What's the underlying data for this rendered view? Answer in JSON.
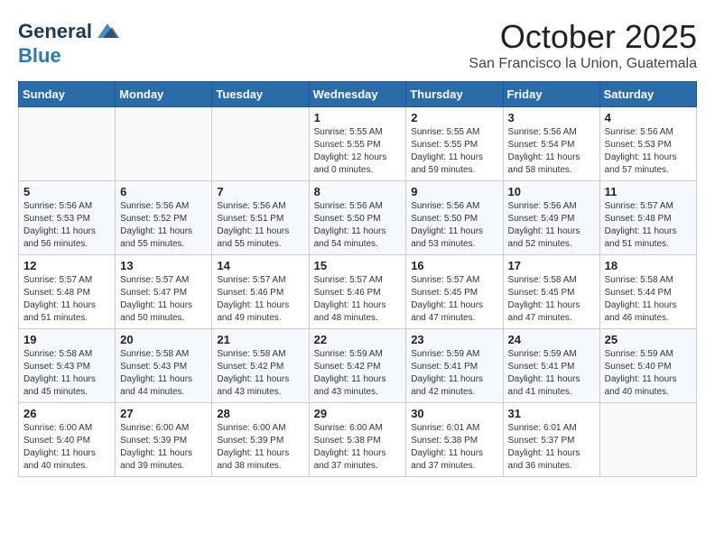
{
  "logo": {
    "line1": "General",
    "line2": "Blue"
  },
  "title": "October 2025",
  "subtitle": "San Francisco la Union, Guatemala",
  "weekdays": [
    "Sunday",
    "Monday",
    "Tuesday",
    "Wednesday",
    "Thursday",
    "Friday",
    "Saturday"
  ],
  "weeks": [
    [
      {
        "day": "",
        "info": ""
      },
      {
        "day": "",
        "info": ""
      },
      {
        "day": "",
        "info": ""
      },
      {
        "day": "1",
        "info": "Sunrise: 5:55 AM\nSunset: 5:55 PM\nDaylight: 12 hours\nand 0 minutes."
      },
      {
        "day": "2",
        "info": "Sunrise: 5:55 AM\nSunset: 5:55 PM\nDaylight: 11 hours\nand 59 minutes."
      },
      {
        "day": "3",
        "info": "Sunrise: 5:56 AM\nSunset: 5:54 PM\nDaylight: 11 hours\nand 58 minutes."
      },
      {
        "day": "4",
        "info": "Sunrise: 5:56 AM\nSunset: 5:53 PM\nDaylight: 11 hours\nand 57 minutes."
      }
    ],
    [
      {
        "day": "5",
        "info": "Sunrise: 5:56 AM\nSunset: 5:53 PM\nDaylight: 11 hours\nand 56 minutes."
      },
      {
        "day": "6",
        "info": "Sunrise: 5:56 AM\nSunset: 5:52 PM\nDaylight: 11 hours\nand 55 minutes."
      },
      {
        "day": "7",
        "info": "Sunrise: 5:56 AM\nSunset: 5:51 PM\nDaylight: 11 hours\nand 55 minutes."
      },
      {
        "day": "8",
        "info": "Sunrise: 5:56 AM\nSunset: 5:50 PM\nDaylight: 11 hours\nand 54 minutes."
      },
      {
        "day": "9",
        "info": "Sunrise: 5:56 AM\nSunset: 5:50 PM\nDaylight: 11 hours\nand 53 minutes."
      },
      {
        "day": "10",
        "info": "Sunrise: 5:56 AM\nSunset: 5:49 PM\nDaylight: 11 hours\nand 52 minutes."
      },
      {
        "day": "11",
        "info": "Sunrise: 5:57 AM\nSunset: 5:48 PM\nDaylight: 11 hours\nand 51 minutes."
      }
    ],
    [
      {
        "day": "12",
        "info": "Sunrise: 5:57 AM\nSunset: 5:48 PM\nDaylight: 11 hours\nand 51 minutes."
      },
      {
        "day": "13",
        "info": "Sunrise: 5:57 AM\nSunset: 5:47 PM\nDaylight: 11 hours\nand 50 minutes."
      },
      {
        "day": "14",
        "info": "Sunrise: 5:57 AM\nSunset: 5:46 PM\nDaylight: 11 hours\nand 49 minutes."
      },
      {
        "day": "15",
        "info": "Sunrise: 5:57 AM\nSunset: 5:46 PM\nDaylight: 11 hours\nand 48 minutes."
      },
      {
        "day": "16",
        "info": "Sunrise: 5:57 AM\nSunset: 5:45 PM\nDaylight: 11 hours\nand 47 minutes."
      },
      {
        "day": "17",
        "info": "Sunrise: 5:58 AM\nSunset: 5:45 PM\nDaylight: 11 hours\nand 47 minutes."
      },
      {
        "day": "18",
        "info": "Sunrise: 5:58 AM\nSunset: 5:44 PM\nDaylight: 11 hours\nand 46 minutes."
      }
    ],
    [
      {
        "day": "19",
        "info": "Sunrise: 5:58 AM\nSunset: 5:43 PM\nDaylight: 11 hours\nand 45 minutes."
      },
      {
        "day": "20",
        "info": "Sunrise: 5:58 AM\nSunset: 5:43 PM\nDaylight: 11 hours\nand 44 minutes."
      },
      {
        "day": "21",
        "info": "Sunrise: 5:58 AM\nSunset: 5:42 PM\nDaylight: 11 hours\nand 43 minutes."
      },
      {
        "day": "22",
        "info": "Sunrise: 5:59 AM\nSunset: 5:42 PM\nDaylight: 11 hours\nand 43 minutes."
      },
      {
        "day": "23",
        "info": "Sunrise: 5:59 AM\nSunset: 5:41 PM\nDaylight: 11 hours\nand 42 minutes."
      },
      {
        "day": "24",
        "info": "Sunrise: 5:59 AM\nSunset: 5:41 PM\nDaylight: 11 hours\nand 41 minutes."
      },
      {
        "day": "25",
        "info": "Sunrise: 5:59 AM\nSunset: 5:40 PM\nDaylight: 11 hours\nand 40 minutes."
      }
    ],
    [
      {
        "day": "26",
        "info": "Sunrise: 6:00 AM\nSunset: 5:40 PM\nDaylight: 11 hours\nand 40 minutes."
      },
      {
        "day": "27",
        "info": "Sunrise: 6:00 AM\nSunset: 5:39 PM\nDaylight: 11 hours\nand 39 minutes."
      },
      {
        "day": "28",
        "info": "Sunrise: 6:00 AM\nSunset: 5:39 PM\nDaylight: 11 hours\nand 38 minutes."
      },
      {
        "day": "29",
        "info": "Sunrise: 6:00 AM\nSunset: 5:38 PM\nDaylight: 11 hours\nand 37 minutes."
      },
      {
        "day": "30",
        "info": "Sunrise: 6:01 AM\nSunset: 5:38 PM\nDaylight: 11 hours\nand 37 minutes."
      },
      {
        "day": "31",
        "info": "Sunrise: 6:01 AM\nSunset: 5:37 PM\nDaylight: 11 hours\nand 36 minutes."
      },
      {
        "day": "",
        "info": ""
      }
    ]
  ]
}
